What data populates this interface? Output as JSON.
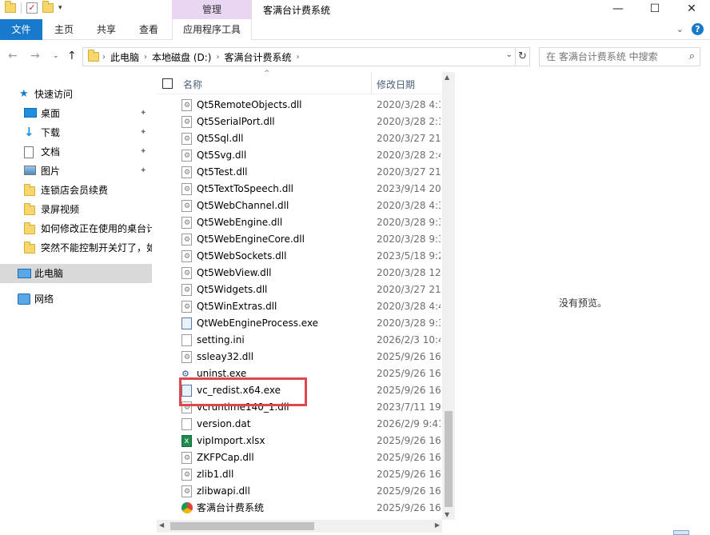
{
  "window": {
    "title": "客满台计费系统",
    "context_tab_header": "管理",
    "minimize": "—",
    "maximize": "☐",
    "close": "✕"
  },
  "ribbon": {
    "tabs": [
      "文件",
      "主页",
      "共享",
      "查看",
      "应用程序工具"
    ],
    "collapse_glyph": "⌄",
    "help_glyph": "?"
  },
  "address": {
    "crumbs": [
      "此电脑",
      "本地磁盘 (D:)",
      "客满台计费系统"
    ],
    "search_placeholder": "在 客满台计费系统 中搜索"
  },
  "nav": {
    "quick_access": "快速访问",
    "items": [
      {
        "label": "桌面",
        "icon": "desktop-icon",
        "pinned": true
      },
      {
        "label": "下载",
        "icon": "download-icon",
        "pinned": true
      },
      {
        "label": "文档",
        "icon": "document-icon",
        "pinned": true
      },
      {
        "label": "图片",
        "icon": "pictures-icon",
        "pinned": true
      },
      {
        "label": "连锁店会员续费",
        "icon": "folder-icon",
        "pinned": false
      },
      {
        "label": "录屏视频",
        "icon": "folder-icon",
        "pinned": false
      },
      {
        "label": "如何修改正在使用的桌台计",
        "icon": "folder-icon",
        "pinned": false
      },
      {
        "label": "突然不能控制开关灯了，如",
        "icon": "folder-icon",
        "pinned": false
      }
    ],
    "this_pc": "此电脑",
    "network": "网络"
  },
  "columns": {
    "name": "名称",
    "date": "修改日期"
  },
  "files": [
    {
      "name": "Qt5RemoteObjects.dll",
      "date": "2020/3/28 4:1",
      "type": "dll"
    },
    {
      "name": "Qt5SerialPort.dll",
      "date": "2020/3/28 2:3",
      "type": "dll"
    },
    {
      "name": "Qt5Sql.dll",
      "date": "2020/3/27 21:",
      "type": "dll"
    },
    {
      "name": "Qt5Svg.dll",
      "date": "2020/3/28 2:4",
      "type": "dll"
    },
    {
      "name": "Qt5Test.dll",
      "date": "2020/3/27 21:",
      "type": "dll"
    },
    {
      "name": "Qt5TextToSpeech.dll",
      "date": "2023/9/14 20:",
      "type": "dll"
    },
    {
      "name": "Qt5WebChannel.dll",
      "date": "2020/3/28 4:3",
      "type": "dll"
    },
    {
      "name": "Qt5WebEngine.dll",
      "date": "2020/3/28 9:3",
      "type": "dll"
    },
    {
      "name": "Qt5WebEngineCore.dll",
      "date": "2020/3/28 9:3",
      "type": "dll"
    },
    {
      "name": "Qt5WebSockets.dll",
      "date": "2023/5/18 9:2",
      "type": "dll"
    },
    {
      "name": "Qt5WebView.dll",
      "date": "2020/3/28 12:",
      "type": "dll"
    },
    {
      "name": "Qt5Widgets.dll",
      "date": "2020/3/27 21:",
      "type": "dll"
    },
    {
      "name": "Qt5WinExtras.dll",
      "date": "2020/3/28 4:4",
      "type": "dll"
    },
    {
      "name": "QtWebEngineProcess.exe",
      "date": "2020/3/28 9:3",
      "type": "exe"
    },
    {
      "name": "setting.ini",
      "date": "2026/2/3 10:4",
      "type": "ini"
    },
    {
      "name": "ssleay32.dll",
      "date": "2025/9/26 16:",
      "type": "dll"
    },
    {
      "name": "uninst.exe",
      "date": "2025/9/26 16:",
      "type": "uninst"
    },
    {
      "name": "vc_redist.x64.exe",
      "date": "2025/9/26 16:",
      "type": "exe"
    },
    {
      "name": "vcruntime140_1.dll",
      "date": "2023/7/11 19:",
      "type": "dll"
    },
    {
      "name": "version.dat",
      "date": "2026/2/9 9:41",
      "type": "dat"
    },
    {
      "name": "vipImport.xlsx",
      "date": "2025/9/26 16:",
      "type": "xlsx"
    },
    {
      "name": "ZKFPCap.dll",
      "date": "2025/9/26 16:",
      "type": "dll"
    },
    {
      "name": "zlib1.dll",
      "date": "2025/9/26 16:",
      "type": "dll"
    },
    {
      "name": "zlibwapi.dll",
      "date": "2025/9/26 16:",
      "type": "dll"
    },
    {
      "name": "客满台计费系统",
      "date": "2025/9/26 16:",
      "type": "chrome"
    }
  ],
  "preview_text": "没有预览。",
  "colors": {
    "accent": "#1979ca",
    "highlight": "#e0474c",
    "context_tab": "#e9d6f3"
  }
}
